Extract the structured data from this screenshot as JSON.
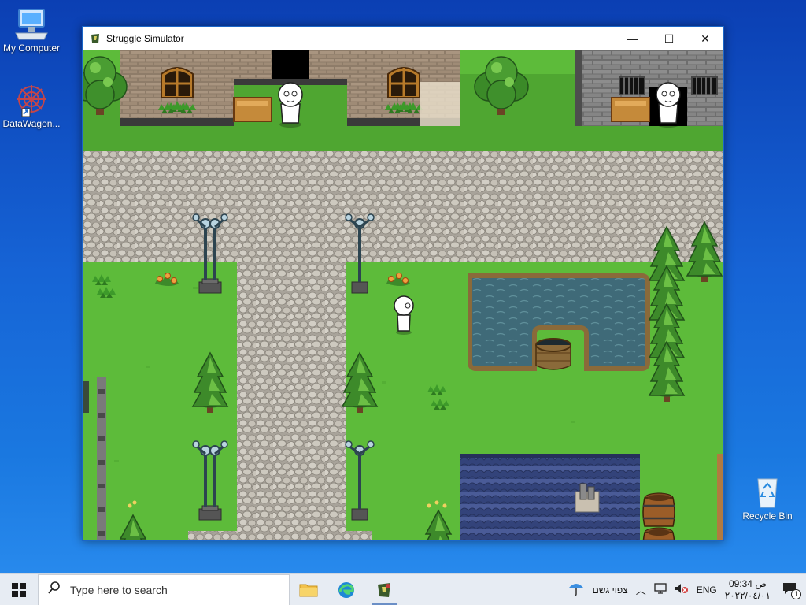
{
  "desktop": {
    "icons": [
      {
        "label": "My Computer"
      },
      {
        "label": "DataWagon..."
      },
      {
        "label": "Recycle Bin"
      }
    ]
  },
  "window": {
    "title": "Struggle Simulator",
    "controls": {
      "minimize": "—",
      "maximize": "☐",
      "close": "✕"
    }
  },
  "taskbar": {
    "search_placeholder": "Type here to search",
    "weather_text": "צפוי גשם",
    "language": "ENG",
    "time": "09:34 ص",
    "date": "٢٠٢٢/٠٤/٠١",
    "notification_count": "1"
  },
  "colors": {
    "grass": "#5dbb3a",
    "path": "#bdb8ae",
    "water": "#3f6a78",
    "roof": "#3e4f8c",
    "accent": "#1a66c8"
  }
}
